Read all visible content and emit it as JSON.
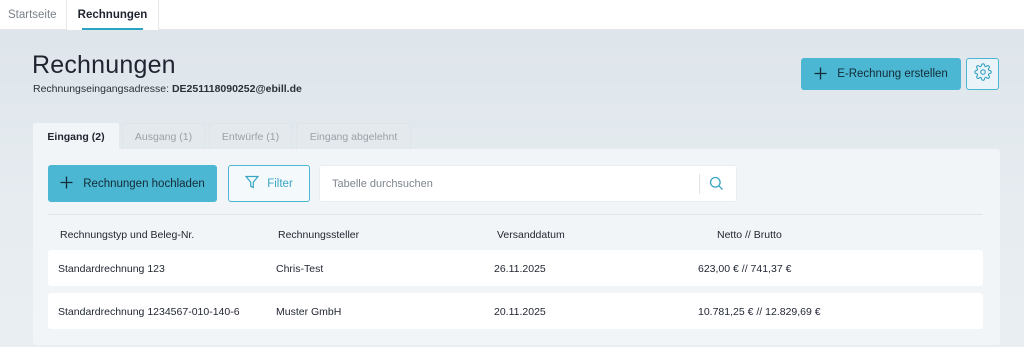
{
  "nav": {
    "tabs": [
      {
        "label": "Startseite"
      },
      {
        "label": "Rechnungen"
      }
    ]
  },
  "header": {
    "title": "Rechnungen",
    "address_label": "Rechnungseingangsadresse:",
    "address_value": "DE251118090252@ebill.de",
    "create_button": "E-Rechnung erstellen"
  },
  "tabs": [
    {
      "label": "Eingang (2)"
    },
    {
      "label": "Ausgang (1)"
    },
    {
      "label": "Entwürfe (1)"
    },
    {
      "label": "Eingang abgelehnt"
    }
  ],
  "toolbar": {
    "upload_label": "Rechnungen hochladen",
    "filter_label": "Filter",
    "search_placeholder": "Tabelle durchsuchen"
  },
  "table": {
    "columns": [
      "Rechnungstyp und Beleg-Nr.",
      "Rechnungssteller",
      "Versanddatum",
      "Netto // Brutto"
    ],
    "rows": [
      [
        "Standardrechnung 123",
        "Chris-Test",
        "26.11.2025",
        "623,00 € // 741,37 €"
      ],
      [
        "Standardrechnung 1234567-010-140-6",
        "Muster GmbH",
        "20.11.2025",
        "10.781,25 € // 12.829,69 €"
      ]
    ]
  },
  "colors": {
    "accent": "#4bb7d3",
    "accent_dark": "#2ca3c4"
  },
  "icons": [
    "plus-icon",
    "gear-icon",
    "filter-icon",
    "search-icon"
  ]
}
